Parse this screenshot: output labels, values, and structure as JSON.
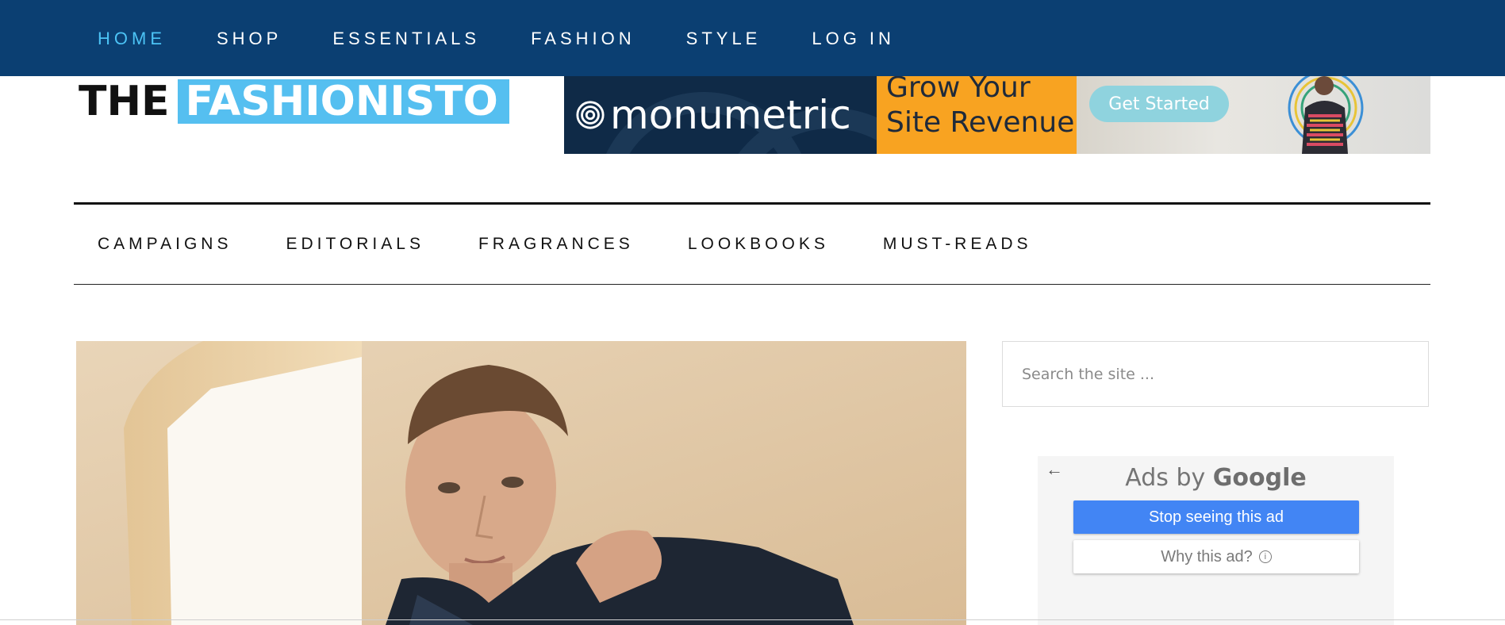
{
  "top_nav": {
    "items": [
      {
        "label": "HOME",
        "active": true
      },
      {
        "label": "SHOP",
        "active": false
      },
      {
        "label": "ESSENTIALS",
        "active": false
      },
      {
        "label": "FASHION",
        "active": false
      },
      {
        "label": "STYLE",
        "active": false
      },
      {
        "label": "LOG IN",
        "active": false
      }
    ]
  },
  "logo": {
    "part1": "THE",
    "part2": "FASHIONISTO"
  },
  "banner_ad": {
    "brand": "monumetric",
    "line1": "Grow Your",
    "line2": "Site Revenue",
    "cta": "Get Started"
  },
  "secondary_nav": {
    "items": [
      "CAMPAIGNS",
      "EDITORIALS",
      "FRAGRANCES",
      "LOOKBOOKS",
      "MUST-READS"
    ]
  },
  "search": {
    "placeholder": "Search the site ..."
  },
  "google_ad": {
    "title_prefix": "Ads by",
    "title_brand": "Google",
    "stop_label": "Stop seeing this ad",
    "why_label": "Why this ad?",
    "info_symbol": "i"
  },
  "colors": {
    "topbar": "#0b3f72",
    "active_nav": "#4cc3f5",
    "logo_accent": "#55bff0",
    "ad_button": "#4285f4"
  }
}
